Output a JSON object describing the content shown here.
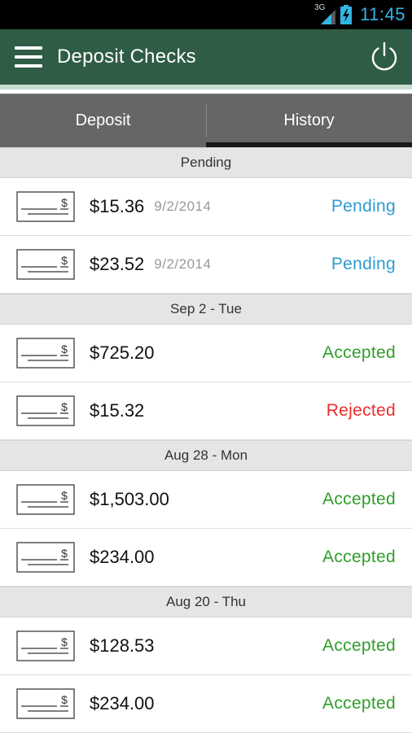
{
  "status_bar": {
    "network_type": "3G",
    "time": "11:45"
  },
  "app_bar": {
    "title": "Deposit Checks",
    "menu_icon": "hamburger-menu-icon",
    "power_icon": "power-icon"
  },
  "tabs": [
    {
      "label": "Deposit",
      "selected": false
    },
    {
      "label": "History",
      "selected": true
    }
  ],
  "colors": {
    "app_bar": "#2f5c45",
    "pending": "#2e9bd0",
    "accepted": "#2f9e2a",
    "rejected": "#ef2b2b",
    "clock": "#33b5e5"
  },
  "sections": [
    {
      "header": "Pending",
      "items": [
        {
          "amount": "$15.36",
          "date": "9/2/2014",
          "status": "Pending"
        },
        {
          "amount": "$23.52",
          "date": "9/2/2014",
          "status": "Pending"
        }
      ]
    },
    {
      "header": "Sep 2 - Tue",
      "items": [
        {
          "amount": "$725.20",
          "date": "",
          "status": "Accepted"
        },
        {
          "amount": "$15.32",
          "date": "",
          "status": "Rejected"
        }
      ]
    },
    {
      "header": "Aug 28 - Mon",
      "items": [
        {
          "amount": "$1,503.00",
          "date": "",
          "status": "Accepted"
        },
        {
          "amount": "$234.00",
          "date": "",
          "status": "Accepted"
        }
      ]
    },
    {
      "header": "Aug 20 - Thu",
      "items": [
        {
          "amount": "$128.53",
          "date": "",
          "status": "Accepted"
        },
        {
          "amount": "$234.00",
          "date": "",
          "status": "Accepted"
        }
      ]
    }
  ]
}
